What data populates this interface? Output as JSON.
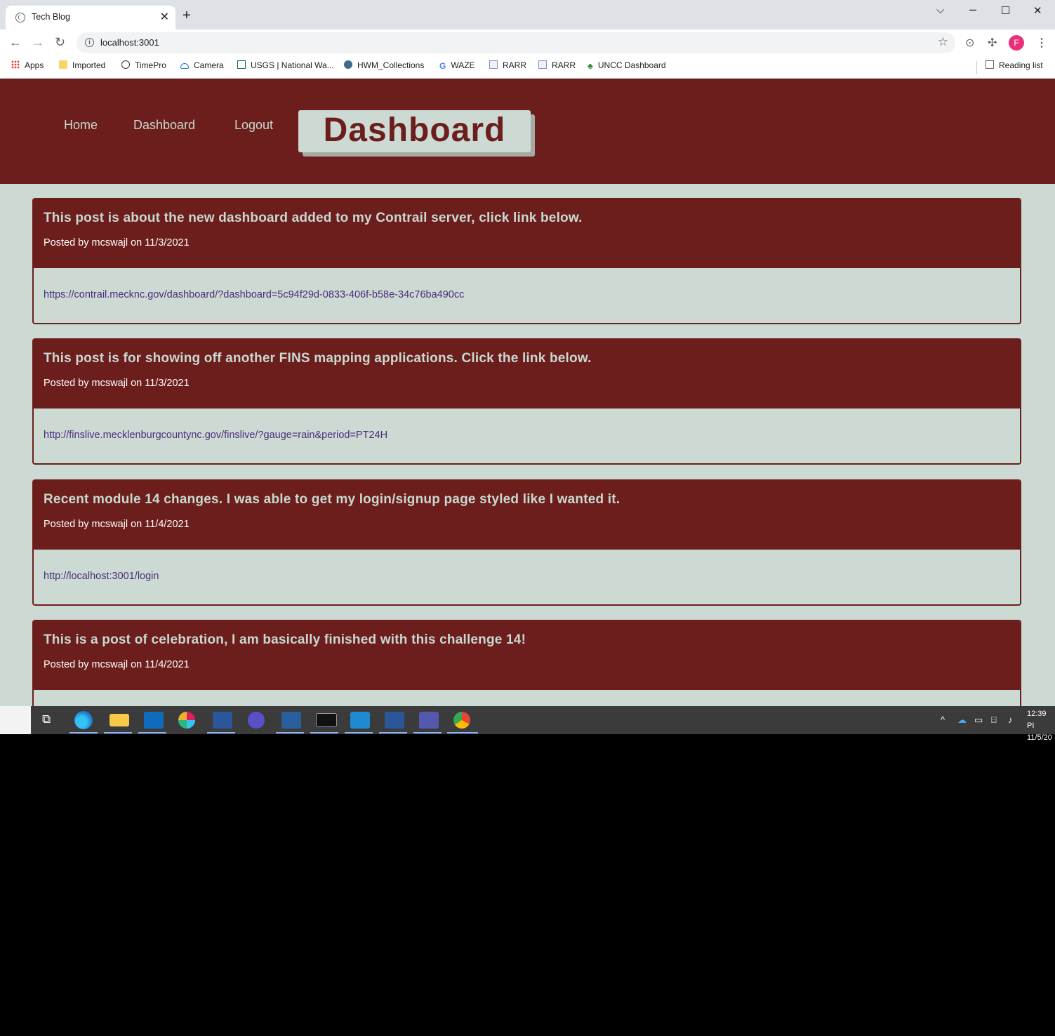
{
  "browser": {
    "tab_title": "Tech Blog",
    "tab_close": "✕",
    "new_tab": "+",
    "url": "localhost:3001",
    "bookmarks": [
      "Apps",
      "Imported",
      "TimePro",
      "Camera",
      "USGS | National Wa...",
      "HWM_Collections",
      "WAZE",
      "RARR",
      "RARR",
      "UNCC Dashboard"
    ],
    "reading_list": "Reading list",
    "profile_initial": "F"
  },
  "site": {
    "nav": [
      "Home",
      "Dashboard",
      "Logout"
    ],
    "title": "Dashboard",
    "colors": {
      "header_bg": "#6b1e1b",
      "page_bg": "#cddad4",
      "link": "#4a2c7a"
    }
  },
  "posts": [
    {
      "title": "This post is about the new dashboard added to my Contrail server, click link below.",
      "meta": "Posted by mcswajl on 11/3/2021",
      "link": "https://contrail.mecknc.gov/dashboard/?dashboard=5c94f29d-0833-406f-b58e-34c76ba490cc"
    },
    {
      "title": "This post is for showing off another FINS mapping applications. Click the link below.",
      "meta": "Posted by mcswajl on 11/3/2021",
      "link": "http://finslive.mecklenburgcountync.gov/finslive/?gauge=rain&period=PT24H"
    },
    {
      "title": "Recent module 14 changes. I was able to get my login/signup page styled like I wanted it.",
      "meta": "Posted by mcswajl on 11/4/2021",
      "link": "http://localhost:3001/login"
    },
    {
      "title": "This is a post of celebration, I am basically finished with this challenge 14!",
      "meta": "Posted by mcswajl on 11/4/2021",
      "link": ""
    }
  ],
  "taskbar": {
    "time": "12:39 PI",
    "date": "11/5/20",
    "apps": [
      "task-view",
      "edge",
      "file-explorer",
      "outlook",
      "slack",
      "visio",
      "eclipse",
      "arcgis",
      "terminal",
      "vscode",
      "word",
      "teams",
      "chrome"
    ]
  }
}
